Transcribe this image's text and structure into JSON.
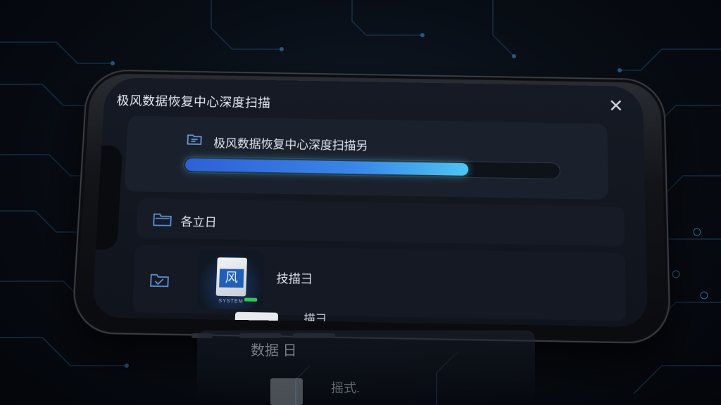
{
  "window": {
    "title": "极风数据恢复中心深度扫描",
    "close_icon": "close-icon"
  },
  "scan_card": {
    "label": "极风数据恢复中心深度扫描另",
    "icon": "folder-chat-icon",
    "progress_percent": 76,
    "progress_colors": [
      "#2f5fd6",
      "#4fc4f2"
    ]
  },
  "rows": [
    {
      "label": "各立日",
      "icon": "folder-icon"
    },
    {
      "label": "技描彐",
      "icon": "folder-check-icon",
      "thumbnail_glyph": "风",
      "thumbnail_caption": "SYSTEM"
    }
  ],
  "peek_row": {
    "label": "描彐"
  },
  "reflection": {
    "line1": "数据 日",
    "line2": "摇式."
  },
  "colors": {
    "background": "#070b12",
    "screen": "#151a24",
    "card": "#1b212c",
    "accent": "#4fc4f2"
  }
}
